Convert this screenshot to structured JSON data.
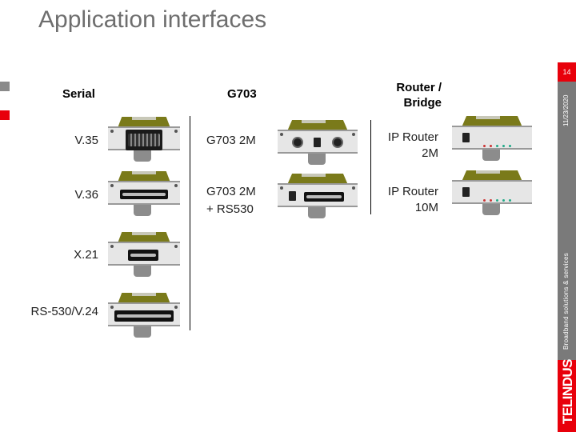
{
  "title": "Application interfaces",
  "page_number": "14",
  "date": "11/23/2020",
  "tagline": "Broadband solutions & services",
  "logo": "TELINDUS",
  "columns": {
    "serial": {
      "header": "Serial",
      "items": [
        {
          "label": "V.35",
          "icon": "v35-connector-card"
        },
        {
          "label": "V.36",
          "icon": "v36-connector-card"
        },
        {
          "label": "X.21",
          "icon": "x21-connector-card"
        },
        {
          "label": "RS-530/V.24",
          "icon": "rs530-v24-connector-card"
        }
      ]
    },
    "g703": {
      "header": "G703",
      "items": [
        {
          "label_line1": "G703 2M",
          "label_line2": "",
          "icon": "g703-2m-card"
        },
        {
          "label_line1": "G703 2M",
          "label_line2": "+ RS530",
          "icon": "g703-2m-rs530-card"
        }
      ]
    },
    "router": {
      "header_line1": "Router /",
      "header_line2": "Bridge",
      "items": [
        {
          "label_line1": "IP Router",
          "label_line2": "2M",
          "icon": "ip-router-2m-card"
        },
        {
          "label_line1": "IP Router",
          "label_line2": "10M",
          "icon": "ip-router-10m-card"
        }
      ]
    }
  },
  "colors": {
    "accent_red": "#e8000b",
    "sidebar_gray": "#7a7a7a",
    "title_gray": "#6e6e6e",
    "card_olive": "#7a7a1a"
  }
}
